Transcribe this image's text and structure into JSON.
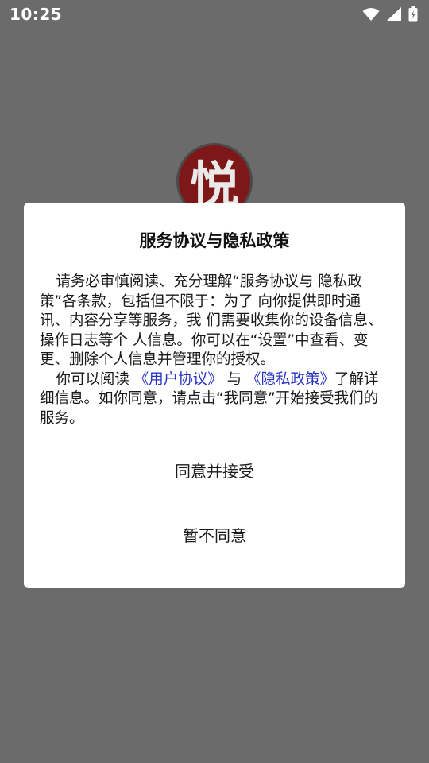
{
  "status_bar": {
    "time": "10:25",
    "icons": [
      "wifi-icon",
      "signal-icon",
      "battery-charging-icon"
    ]
  },
  "app": {
    "logo_glyph": "悦",
    "colors": {
      "logo": "#7e1717",
      "overlay": "#6b6b6b",
      "link": "#2633c5"
    }
  },
  "dialog": {
    "title": "服务协议与隐私政策",
    "paragraph1": "请务必审慎阅读、充分理解“服务协议与 隐私政策”各条款，包括但不限于：为了 向你提供即时通讯、内容分享等服务，我 们需要收集你的设备信息、操作日志等个 人信息。你可以在“设置”中查看、变更、删除个人信息并管理你的授权。",
    "paragraph2_prefix": "你可以阅读 ",
    "user_agreement_link": "《用户协议》",
    "paragraph2_and": " 与 ",
    "privacy_policy_link": "《隐私政策》",
    "paragraph2_suffix": "了解详细信息。如你同意，请点击“我同意”开始接受我们的服务。",
    "accept_label": "同意并接受",
    "decline_label": "暂不同意"
  }
}
